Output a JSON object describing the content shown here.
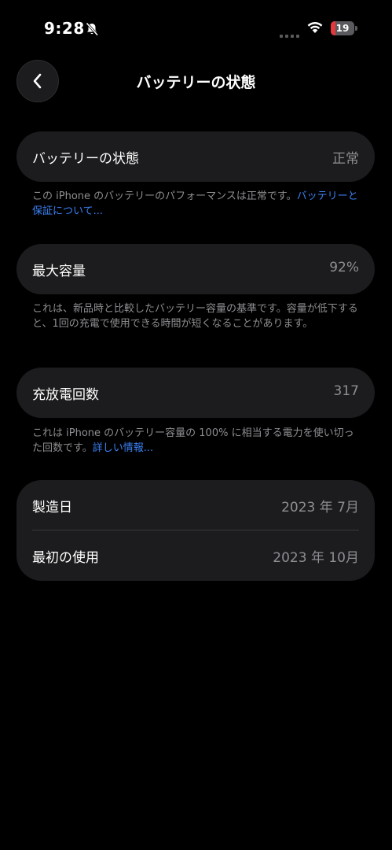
{
  "status_bar": {
    "time": "9:28",
    "battery_level": "19",
    "battery_fraction": 0.19,
    "battery_color": "#e5383b"
  },
  "header": {
    "title": "バッテリーの状態",
    "back_icon": "chevron-left-icon"
  },
  "sections": {
    "health": {
      "label": "バッテリーの状態",
      "value": "正常",
      "footnote": "この iPhone のバッテリーのパフォーマンスは正常です。",
      "link": "バッテリーと保証について..."
    },
    "capacity": {
      "label": "最大容量",
      "value": "92%",
      "footnote": "これは、新品時と比較したバッテリー容量の基準です。容量が低下すると、1回の充電で使用できる時間が短くなることがあります。"
    },
    "cycles": {
      "label": "充放電回数",
      "value": "317",
      "footnote": "これは iPhone のバッテリー容量の 100% に相当する電力を使い切った回数です。",
      "link": "詳しい情報..."
    },
    "dates": {
      "manufactured_label": "製造日",
      "manufactured_value": "2023 年 7月",
      "first_use_label": "最初の使用",
      "first_use_value": "2023 年 10月"
    }
  },
  "colors": {
    "background": "#000000",
    "card": "#1c1c1e",
    "secondary_text": "#8e8e93",
    "link": "#3b82f6"
  }
}
